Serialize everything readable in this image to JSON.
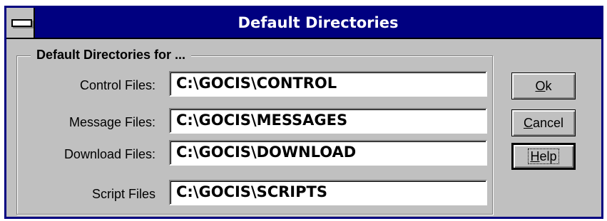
{
  "window": {
    "title": "Default Directories"
  },
  "group": {
    "label": "Default Directories for ..."
  },
  "rows": [
    {
      "label": "Control Files:",
      "value": "C:\\GOCIS\\CONTROL"
    },
    {
      "label": "Message Files:",
      "value": "C:\\GOCIS\\MESSAGES"
    },
    {
      "label": "Download Files:",
      "value": "C:\\GOCIS\\DOWNLOAD"
    },
    {
      "label": "Script Files",
      "value": "C:\\GOCIS\\SCRIPTS"
    }
  ],
  "buttons": {
    "ok": {
      "mnemonic": "O",
      "rest": "k"
    },
    "cancel": {
      "mnemonic": "C",
      "rest": "ancel"
    },
    "help": {
      "mnemonic": "H",
      "rest": "elp"
    }
  },
  "colors": {
    "titlebar": "#000080",
    "face": "#c0c0c0"
  },
  "icons": {
    "system_menu": "system-menu-icon"
  }
}
